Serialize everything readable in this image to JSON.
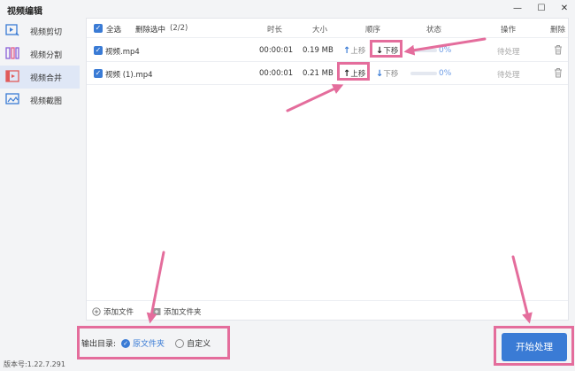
{
  "window": {
    "title": "视频编辑",
    "min": "—",
    "max": "☐",
    "close": "✕"
  },
  "sidebar": {
    "items": [
      {
        "label": "视频剪切",
        "icon": "video-cut-icon"
      },
      {
        "label": "视频分割",
        "icon": "video-split-icon"
      },
      {
        "label": "视频合并",
        "icon": "video-merge-icon",
        "active": true
      },
      {
        "label": "视频截图",
        "icon": "video-screenshot-icon"
      }
    ],
    "version": "版本号:1.22.7.291"
  },
  "table": {
    "select_all": "全选",
    "delete_selected": "删除选中",
    "count": "(2/2)",
    "headers": {
      "duration": "时长",
      "size": "大小",
      "order": "顺序",
      "status": "状态",
      "action": "操作",
      "delete": "删除"
    },
    "rows": [
      {
        "name": "视频.mp4",
        "duration": "00:00:01",
        "size": "0.19 MB",
        "up": "上移",
        "down": "下移",
        "progress": "0%",
        "action": "待处理"
      },
      {
        "name": "视频 (1).mp4",
        "duration": "00:00:01",
        "size": "0.21 MB",
        "up": "上移",
        "down": "下移",
        "progress": "0%",
        "action": "待处理"
      }
    ],
    "add_file": "添加文件",
    "add_folder": "添加文件夹"
  },
  "output": {
    "label": "输出目录:",
    "option_original": "原文件夹",
    "option_custom": "自定义"
  },
  "start_button": "开始处理",
  "colors": {
    "accent": "#3a7bd5",
    "annotation": "#e46d9c"
  }
}
